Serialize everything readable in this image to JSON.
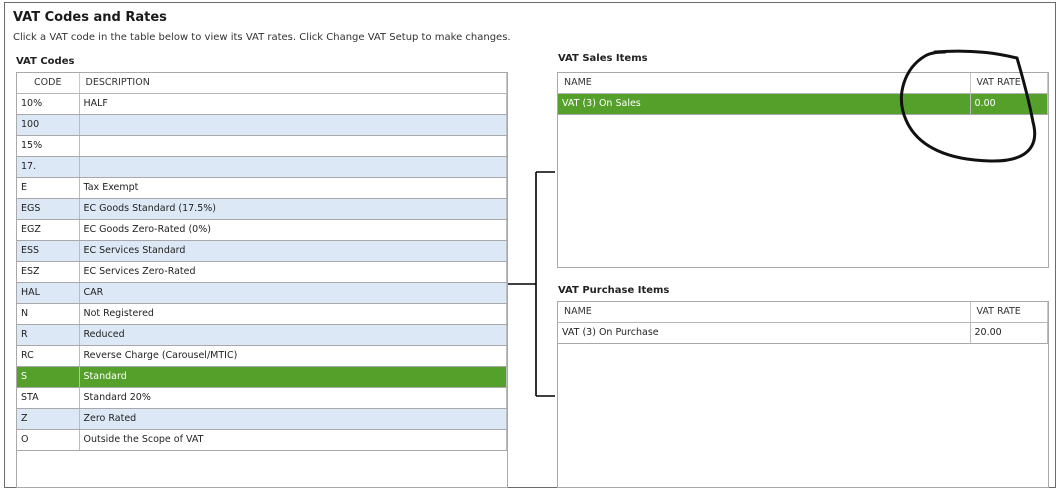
{
  "page": {
    "title": "VAT Codes and Rates",
    "instructions": "Click a VAT code in the table below to view its VAT rates. Click Change VAT Setup to make changes."
  },
  "vat_codes": {
    "label": "VAT Codes",
    "columns": [
      "CODE",
      "DESCRIPTION"
    ],
    "selected_code": "S",
    "rows": [
      {
        "code": "10%",
        "description": "HALF"
      },
      {
        "code": "100",
        "description": ""
      },
      {
        "code": "15%",
        "description": ""
      },
      {
        "code": "17.",
        "description": ""
      },
      {
        "code": "E",
        "description": "Tax Exempt"
      },
      {
        "code": "EGS",
        "description": "EC Goods Standard (17.5%)"
      },
      {
        "code": "EGZ",
        "description": "EC Goods Zero-Rated (0%)"
      },
      {
        "code": "ESS",
        "description": "EC Services Standard"
      },
      {
        "code": "ESZ",
        "description": "EC Services Zero-Rated"
      },
      {
        "code": "HAL",
        "description": "CAR"
      },
      {
        "code": "N",
        "description": "Not Registered"
      },
      {
        "code": "R",
        "description": "Reduced"
      },
      {
        "code": "RC",
        "description": "Reverse Charge (Carousel/MTIC)"
      },
      {
        "code": "S",
        "description": "Standard"
      },
      {
        "code": "STA",
        "description": "Standard 20%"
      },
      {
        "code": "Z",
        "description": "Zero Rated"
      },
      {
        "code": "O",
        "description": "Outside the Scope of VAT"
      }
    ]
  },
  "vat_sales_items": {
    "label": "VAT Sales Items",
    "columns": [
      "NAME",
      "VAT RATE"
    ],
    "rows": [
      {
        "name": "VAT (3) On Sales",
        "rate": "0.00",
        "selected": true
      }
    ]
  },
  "vat_purchase_items": {
    "label": "VAT Purchase Items",
    "columns": [
      "NAME",
      "VAT RATE"
    ],
    "rows": [
      {
        "name": "VAT (3) On Purchase",
        "rate": "20.00",
        "selected": false
      }
    ]
  },
  "colors": {
    "selected_row": "#55a02a",
    "alternate_row": "#dde8f6",
    "grid_line": "#a8a8a8"
  }
}
